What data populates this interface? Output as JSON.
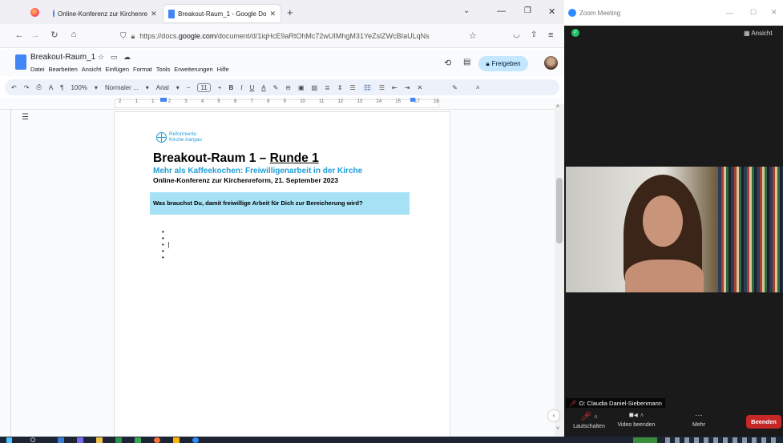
{
  "browser": {
    "tabs": [
      {
        "title": "Online-Konferenz zur Kirchenre",
        "active": false
      },
      {
        "title": "Breakout-Raum_1 - Google Do",
        "active": true
      }
    ],
    "new_tab": "+",
    "url_prefix": "https://docs.",
    "url_domain": "google.com",
    "url_path": "/document/d/1iqHcE9aRtOhMc72wUIMhgM31YeZslZWcBIaULqNs"
  },
  "doc": {
    "title": "Breakout-Raum_1",
    "menu": [
      "Datei",
      "Bearbeiten",
      "Ansicht",
      "Einfügen",
      "Format",
      "Tools",
      "Erweiterungen",
      "Hilfe"
    ],
    "share_label": "Freigeben",
    "toolbar": {
      "zoom": "100%",
      "style": "Normaler ...",
      "font": "Arial",
      "font_size": "11"
    },
    "logo_line1": "Reformierte",
    "logo_line2": "Kirche Aargau",
    "heading_prefix": "Breakout-Raum 1 – ",
    "heading_underlined": "Runde 1",
    "subtitle": "Mehr als Kaffeekochen: Freiwilligenarbeit in der Kirche",
    "conference_line": "Online-Konferenz zur Kirchenreform, 21. September 2023",
    "question": "Was brauchst Du, damit freiwillige Arbeit für Dich zur Bereicherung wird?"
  },
  "ruler": {
    "ticks": [
      "2",
      "1",
      "1",
      "2",
      "3",
      "4",
      "5",
      "6",
      "7",
      "8",
      "9",
      "10",
      "11",
      "12",
      "13",
      "14",
      "15",
      "17",
      "18"
    ]
  },
  "zoom": {
    "window_title": "Zoom Meeting",
    "view_label": "Ansicht",
    "participant_name": "O: Claudia Daniel-Siebenmann",
    "mute_label": "Lautschalten",
    "video_label": "Video beenden",
    "more_label": "Mehr",
    "end_label": "Beenden"
  },
  "colors": {
    "docs_blue": "#1a73e8",
    "share_bg": "#c2e7ff",
    "question_bg": "#a6e1f5",
    "subtitle": "#1f9ed8",
    "end_red": "#c62828"
  }
}
